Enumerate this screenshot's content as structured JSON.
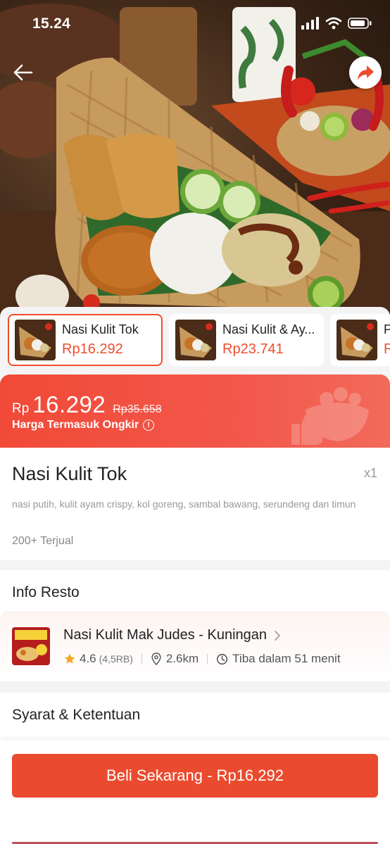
{
  "status_bar": {
    "time": "15.24"
  },
  "hero": {
    "image_alt": "Nasi kulit dish on bamboo tray"
  },
  "variants": [
    {
      "name": "Nasi Kulit Tok",
      "price": "Rp16.292",
      "active": true
    },
    {
      "name": "Nasi Kulit & Ay...",
      "price": "Rp23.741",
      "active": false
    },
    {
      "name": "P",
      "price": "R",
      "active": false
    }
  ],
  "price_banner": {
    "currency": "Rp",
    "price": "16.292",
    "old_price": "Rp35.658",
    "note": "Harga Termasuk Ongkir",
    "info_icon_glyph": "!"
  },
  "product": {
    "title": "Nasi Kulit Tok",
    "qty": "x1",
    "description": "nasi putih, kulit ayam crispy, kol goreng, sambal bawang, serundeng dan timun",
    "sold": "200+ Terjual"
  },
  "resto": {
    "section_title": "Info Resto",
    "name": "Nasi Kulit Mak Judes - Kuningan",
    "rating": "4.6",
    "rating_count": "(4,5RB)",
    "distance": "2.6km",
    "eta": "Tiba dalam 51 menit"
  },
  "terms": {
    "title": "Syarat & Ketentuan"
  },
  "buy": {
    "label": "Beli Sekarang - Rp16.292"
  },
  "colors": {
    "accent": "#ee4d2d",
    "button": "#ea4b2e",
    "star": "#f5a623"
  }
}
